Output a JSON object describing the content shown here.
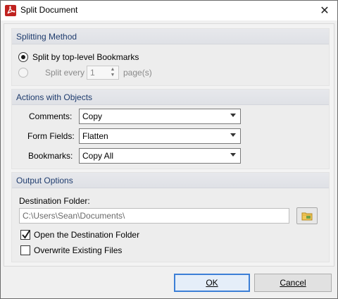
{
  "window": {
    "title": "Split Document",
    "app_icon": "pdf-app-icon",
    "close_glyph": "✕"
  },
  "splitting_method": {
    "header": "Splitting Method",
    "option_bookmarks_label": "Split by top-level Bookmarks",
    "option_bookmarks_selected": true,
    "option_pages_label": "Split every",
    "option_pages_selected": false,
    "pages_value": "1",
    "pages_suffix": "page(s)"
  },
  "actions": {
    "header": "Actions with Objects",
    "comments_label": "Comments:",
    "comments_value": "Copy",
    "form_fields_label": "Form Fields:",
    "form_fields_value": "Flatten",
    "bookmarks_label": "Bookmarks:",
    "bookmarks_value": "Copy All"
  },
  "output": {
    "header": "Output Options",
    "destination_label": "Destination Folder:",
    "destination_value": "C:\\Users\\Sean\\Documents\\",
    "browse_icon": "folder-browse-icon",
    "open_folder_label": "Open the Destination Folder",
    "open_folder_checked": true,
    "overwrite_label": "Overwrite Existing Files",
    "overwrite_checked": false
  },
  "buttons": {
    "ok_label": "OK",
    "cancel_label": "Cancel"
  },
  "colors": {
    "group_header_text": "#1f3c6e",
    "default_button_border": "#3c7fd6",
    "app_icon": "#c0221f"
  }
}
